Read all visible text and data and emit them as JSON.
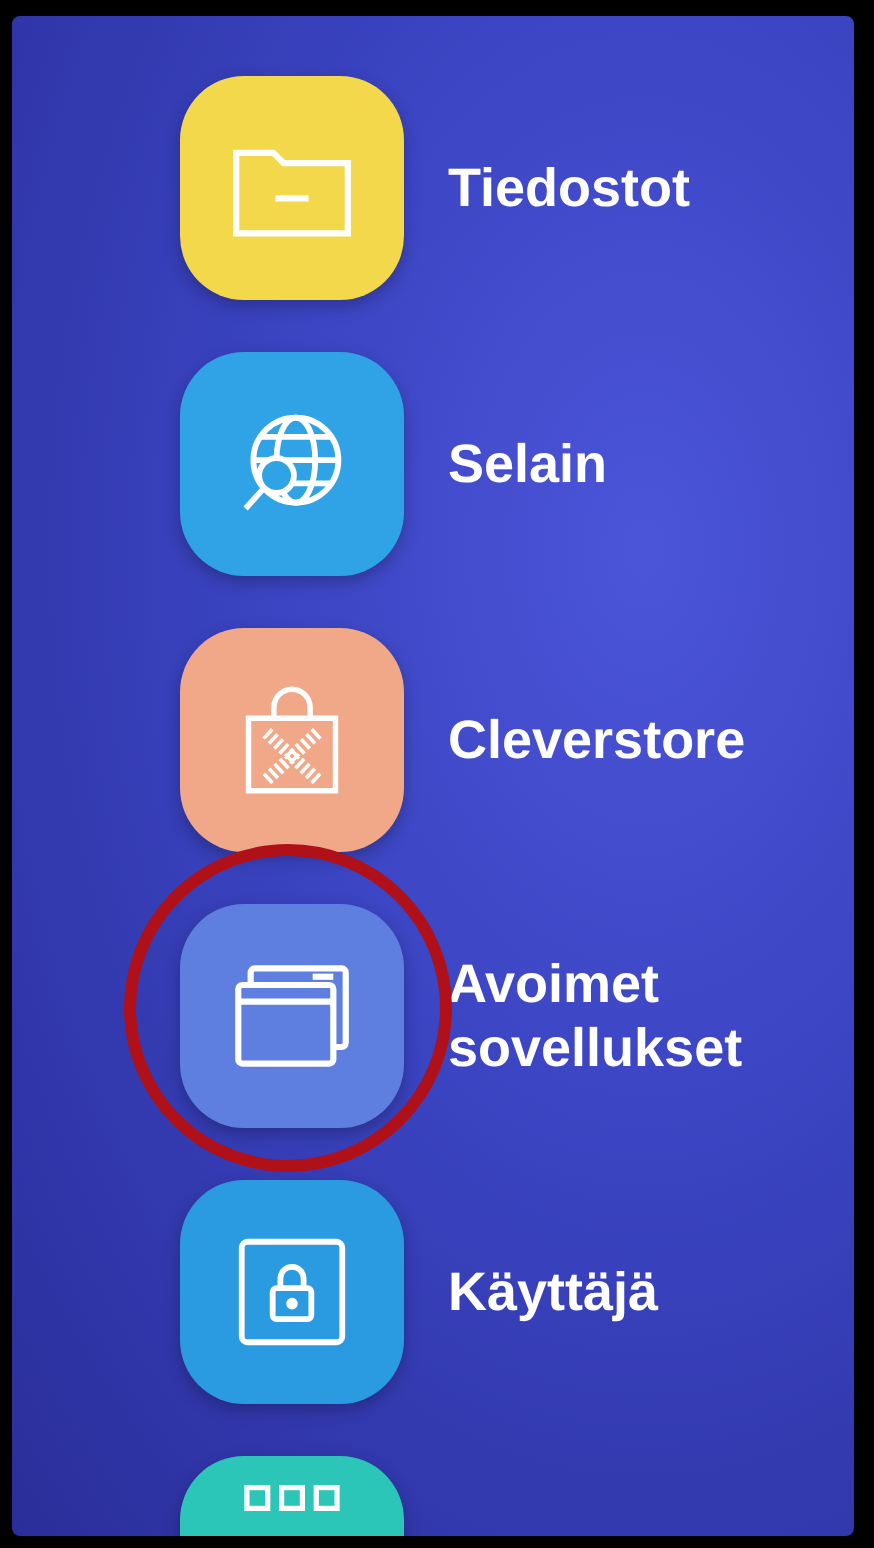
{
  "apps": [
    {
      "kind": "folder",
      "label": "Tiedostot",
      "color": "#f2d84a",
      "circled": false
    },
    {
      "kind": "globe",
      "label": "Selain",
      "color": "#2fa3e6",
      "circled": false
    },
    {
      "kind": "bag",
      "label": "Cleverstore",
      "color": "#f0a889",
      "circled": false
    },
    {
      "kind": "windows",
      "label": "Avoimet sovellukset",
      "color": "#5f7fe0",
      "circled": true
    },
    {
      "kind": "lock",
      "label": "Käyttäjä",
      "color": "#2a9be0",
      "circled": false
    },
    {
      "kind": "grid",
      "color": "#2cc6b8",
      "circled": false
    }
  ]
}
